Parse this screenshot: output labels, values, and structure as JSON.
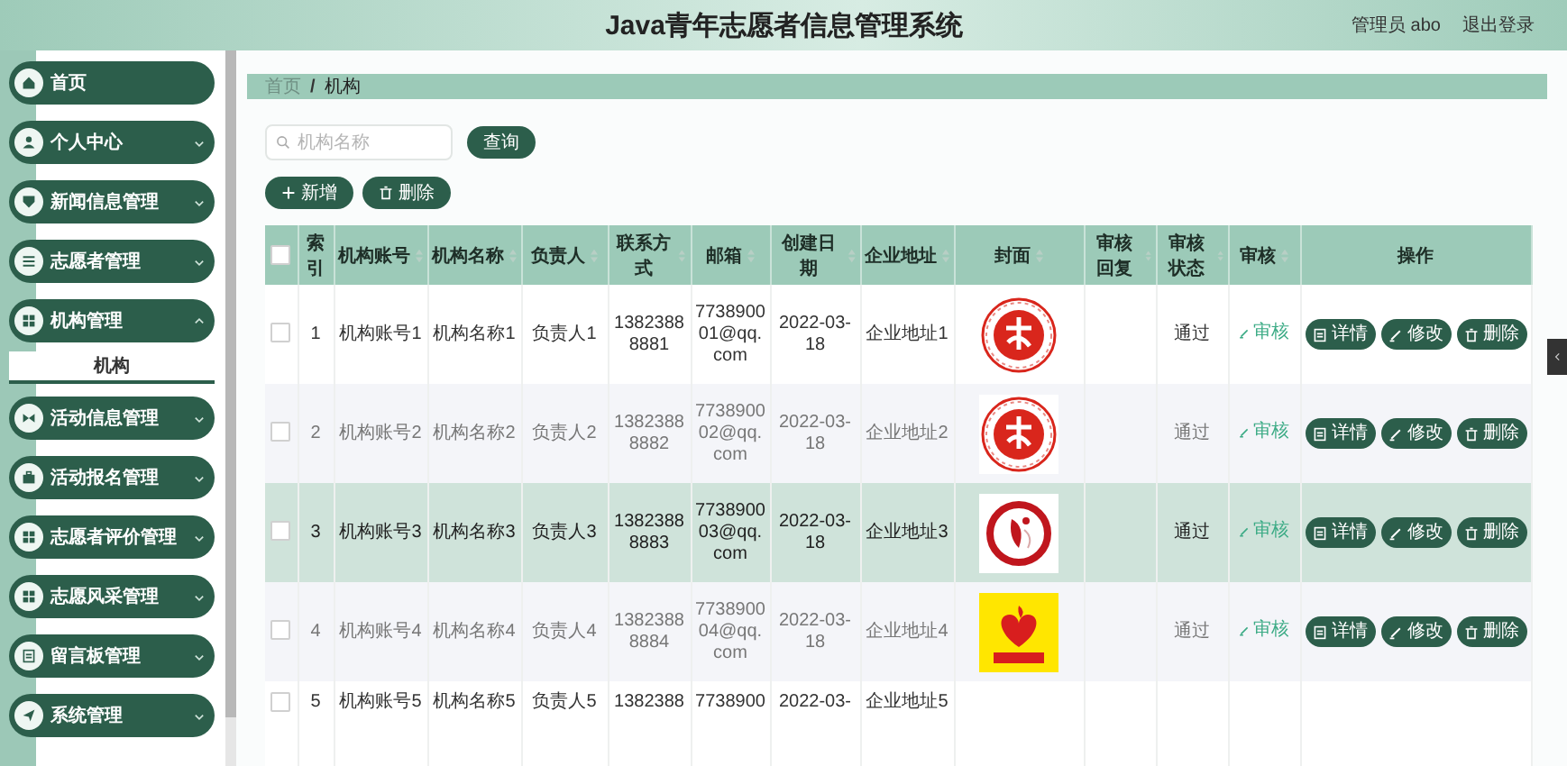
{
  "header": {
    "title": "Java青年志愿者信息管理系统",
    "user": "管理员 abo",
    "logout": "退出登录"
  },
  "sidebar": {
    "items": [
      {
        "label": "首页",
        "has_children": false
      },
      {
        "label": "个人中心",
        "has_children": true,
        "expanded": false
      },
      {
        "label": "新闻信息管理",
        "has_children": true,
        "expanded": false
      },
      {
        "label": "志愿者管理",
        "has_children": true,
        "expanded": false
      },
      {
        "label": "机构管理",
        "has_children": true,
        "expanded": true,
        "children": [
          {
            "label": "机构",
            "selected": true
          }
        ]
      },
      {
        "label": "活动信息管理",
        "has_children": true,
        "expanded": false
      },
      {
        "label": "活动报名管理",
        "has_children": true,
        "expanded": false
      },
      {
        "label": "志愿者评价管理",
        "has_children": true,
        "expanded": false
      },
      {
        "label": "志愿风采管理",
        "has_children": true,
        "expanded": false
      },
      {
        "label": "留言板管理",
        "has_children": true,
        "expanded": false
      },
      {
        "label": "系统管理",
        "has_children": true,
        "expanded": false
      }
    ]
  },
  "breadcrumb": {
    "items": [
      {
        "label": "首页",
        "current": false
      },
      {
        "label": "机构",
        "current": true
      }
    ],
    "separator": "/"
  },
  "search": {
    "placeholder": "机构名称",
    "button": "查询"
  },
  "toolbar": [
    {
      "label": "新增",
      "kind": "add"
    },
    {
      "label": "删除",
      "kind": "delete"
    }
  ],
  "table": {
    "columns": [
      {
        "kind": "checkbox",
        "checked": false
      },
      {
        "kind": "text",
        "label": "索引",
        "sortable": false
      },
      {
        "kind": "text",
        "label": "机构账号",
        "sortable": true
      },
      {
        "kind": "text",
        "label": "机构名称",
        "sortable": true
      },
      {
        "kind": "text",
        "label": "负责人",
        "sortable": true
      },
      {
        "kind": "text",
        "label": "联系方式",
        "sortable": true
      },
      {
        "kind": "text",
        "label": "邮箱",
        "sortable": true
      },
      {
        "kind": "text",
        "label": "创建日期",
        "sortable": true
      },
      {
        "kind": "text",
        "label": "企业地址",
        "sortable": true
      },
      {
        "kind": "text",
        "label": "封面",
        "sortable": true
      },
      {
        "kind": "text",
        "label": "审核回复",
        "sortable": true
      },
      {
        "kind": "text",
        "label": "审核状态",
        "sortable": true
      },
      {
        "kind": "text",
        "label": "审核",
        "sortable": true
      },
      {
        "kind": "text",
        "label": "操作",
        "sortable": false
      }
    ],
    "rows": [
      {
        "checked": false,
        "highlighted": false,
        "index": "1",
        "account": "机构账号1",
        "name": "机构名称1",
        "person": "负责人1",
        "phone": "13823888881",
        "email": "773890001@qq.com",
        "date": "2022-03-18",
        "address": "企业地址1",
        "status": "通过",
        "audit": "审核",
        "actions": [
          {
            "label": "详情",
            "kind": "detail"
          },
          {
            "label": "修改",
            "kind": "edit"
          },
          {
            "label": "删除",
            "kind": "delete"
          }
        ]
      },
      {
        "checked": false,
        "highlighted": false,
        "index": "2",
        "account": "机构账号2",
        "name": "机构名称2",
        "person": "负责人2",
        "phone": "13823888882",
        "email": "773890002@qq.com",
        "date": "2022-03-18",
        "address": "企业地址2",
        "status": "通过",
        "audit": "审核",
        "actions": [
          {
            "label": "详情",
            "kind": "detail"
          },
          {
            "label": "修改",
            "kind": "edit"
          },
          {
            "label": "删除",
            "kind": "delete"
          }
        ]
      },
      {
        "checked": false,
        "highlighted": true,
        "index": "3",
        "account": "机构账号3",
        "name": "机构名称3",
        "person": "负责人3",
        "phone": "13823888883",
        "email": "773890003@qq.com",
        "date": "2022-03-18",
        "address": "企业地址3",
        "status": "通过",
        "audit": "审核",
        "actions": [
          {
            "label": "详情",
            "kind": "detail"
          },
          {
            "label": "修改",
            "kind": "edit"
          },
          {
            "label": "删除",
            "kind": "delete"
          }
        ]
      },
      {
        "checked": false,
        "highlighted": false,
        "index": "4",
        "account": "机构账号4",
        "name": "机构名称4",
        "person": "负责人4",
        "phone": "13823888884",
        "email": "773890004@qq.com",
        "date": "2022-03-18",
        "address": "企业地址4",
        "status": "通过",
        "audit": "审核",
        "actions": [
          {
            "label": "详情",
            "kind": "detail"
          },
          {
            "label": "修改",
            "kind": "edit"
          },
          {
            "label": "删除",
            "kind": "delete"
          }
        ]
      },
      {
        "checked": false,
        "highlighted": false,
        "partial": true,
        "index": "5",
        "account": "机构账号5",
        "name": "机构名称5",
        "person": "负责人5",
        "phone": "1382388",
        "email": "7738900",
        "date": "2022-03-",
        "address": "企业地址5"
      }
    ]
  }
}
